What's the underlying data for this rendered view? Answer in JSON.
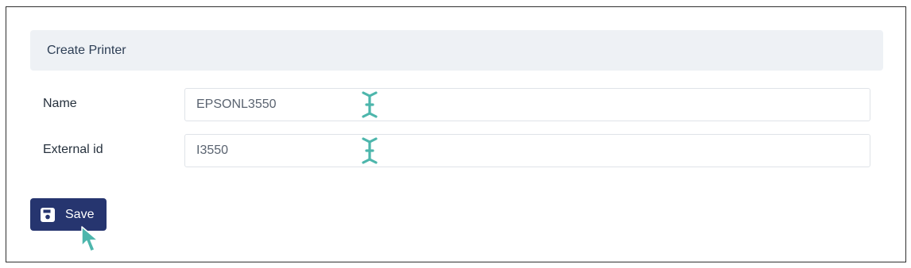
{
  "card": {
    "title": "Create Printer"
  },
  "form": {
    "name": {
      "label": "Name",
      "value": "EPSONL3550"
    },
    "external_id": {
      "label": "External id",
      "value": "I3550"
    }
  },
  "actions": {
    "save_label": "Save"
  },
  "colors": {
    "primary_button": "#26356f",
    "header_background": "#eef1f5",
    "cursor_accent": "#4db6ac"
  },
  "icons": {
    "save": "floppy-disk-icon",
    "text_cursor": "i-beam-cursor-icon",
    "mouse": "mouse-pointer-icon"
  }
}
